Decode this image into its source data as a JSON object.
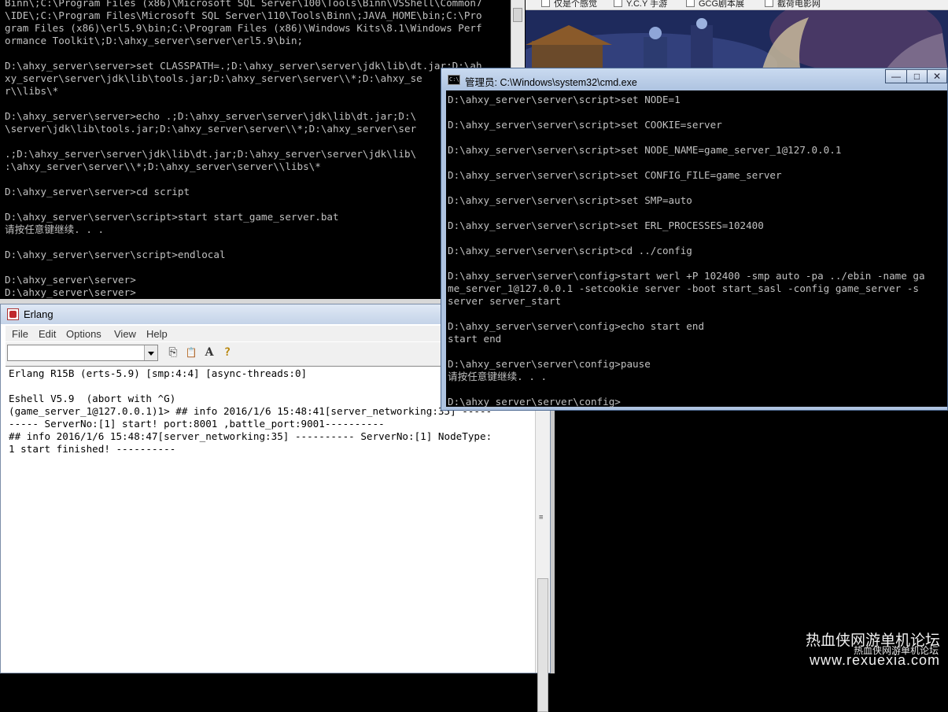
{
  "desktop": {
    "tabs": [
      "仅是个感觉",
      "Y.C.Y 手游",
      "GCG剧本展",
      "截荷电影网"
    ]
  },
  "cmd_bg": {
    "lines": [
      "Binn\\;C:\\Program Files (x86)\\Microsoft SQL Server\\100\\Tools\\Binn\\VSShell\\Common7",
      "\\IDE\\;C:\\Program Files\\Microsoft SQL Server\\110\\Tools\\Binn\\;JAVA_HOME\\bin;C:\\Pro",
      "gram Files (x86)\\erl5.9\\bin;C:\\Program Files (x86)\\Windows Kits\\8.1\\Windows Perf",
      "ormance Toolkit\\;D:\\ahxy_server\\server\\erl5.9\\bin;",
      "",
      "D:\\ahxy_server\\server>set CLASSPATH=.;D:\\ahxy_server\\server\\jdk\\lib\\dt.jar;D:\\ah",
      "xy_server\\server\\jdk\\lib\\tools.jar;D:\\ahxy_server\\server\\\\*;D:\\ahxy_se",
      "r\\\\libs\\*",
      "",
      "D:\\ahxy_server\\server>echo .;D:\\ahxy_server\\server\\jdk\\lib\\dt.jar;D:\\",
      "\\server\\jdk\\lib\\tools.jar;D:\\ahxy_server\\server\\\\*;D:\\ahxy_server\\ser",
      "",
      ".;D:\\ahxy_server\\server\\jdk\\lib\\dt.jar;D:\\ahxy_server\\server\\jdk\\lib\\",
      ":\\ahxy_server\\server\\\\*;D:\\ahxy_server\\server\\\\libs\\*",
      "",
      "D:\\ahxy_server\\server>cd script",
      "",
      "D:\\ahxy_server\\server\\script>start start_game_server.bat",
      "请按任意键继续. . .",
      "",
      "D:\\ahxy_server\\server\\script>endlocal",
      "",
      "D:\\ahxy_server\\server>",
      "D:\\ahxy_server\\server>"
    ]
  },
  "erlang": {
    "title": "Erlang",
    "menu": [
      "File",
      "Edit",
      "Options",
      "View",
      "Help"
    ],
    "combo_value": "",
    "toolbar_icons": [
      "copy-icon",
      "paste-icon",
      "font-icon",
      "help-icon"
    ],
    "toolbar_glyphs": [
      "⎘",
      "📋",
      "A",
      "?"
    ],
    "shell_lines": [
      "Erlang R15B (erts-5.9) [smp:4:4] [async-threads:0]",
      "",
      "Eshell V5.9  (abort with ^G)",
      "(game_server_1@127.0.0.1)1> ## info 2016/1/6 15:48:41[server_networking:35] -----",
      "----- ServerNo:[1] start! port:8001 ,battle_port:9001----------",
      "## info 2016/1/6 15:48:47[server_networking:35] ---------- ServerNo:[1] NodeType:",
      "1 start finished! ----------"
    ]
  },
  "cmd_front": {
    "title": "管理员: C:\\Windows\\system32\\cmd.exe",
    "icon_text": "C:\\",
    "buttons": [
      "minimize",
      "maximize",
      "close"
    ],
    "button_glyphs": [
      "—",
      "□",
      "✕"
    ],
    "lines": [
      "D:\\ahxy_server\\server\\script>set NODE=1",
      "",
      "D:\\ahxy_server\\server\\script>set COOKIE=server",
      "",
      "D:\\ahxy_server\\server\\script>set NODE_NAME=game_server_1@127.0.0.1",
      "",
      "D:\\ahxy_server\\server\\script>set CONFIG_FILE=game_server",
      "",
      "D:\\ahxy_server\\server\\script>set SMP=auto",
      "",
      "D:\\ahxy_server\\server\\script>set ERL_PROCESSES=102400",
      "",
      "D:\\ahxy_server\\server\\script>cd ../config",
      "",
      "D:\\ahxy_server\\server\\config>start werl +P 102400 -smp auto -pa ../ebin -name ga",
      "me_server_1@127.0.0.1 -setcookie server -boot start_sasl -config game_server -s",
      "server server_start",
      "",
      "D:\\ahxy_server\\server\\config>echo start end",
      "start end",
      "",
      "D:\\ahxy_server\\server\\config>pause",
      "请按任意键继续. . .",
      "",
      "D:\\ahxy_server\\server\\config>"
    ]
  },
  "watermark": {
    "title": "热血侠网游单机论坛",
    "url": "www.rexuexia.com",
    "overlay": "热血侠网游单机论坛"
  },
  "colors": {
    "console_text": "#c0c0c0",
    "console_bg": "#000000",
    "titlebar": "#aec3e0"
  }
}
